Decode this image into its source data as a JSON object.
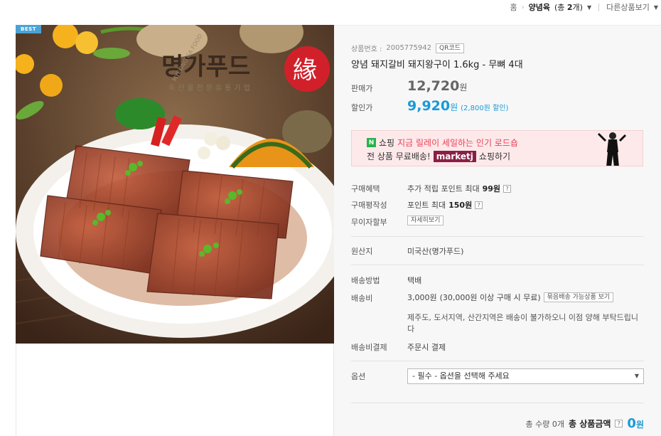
{
  "breadcrumb": {
    "home": "홈",
    "category": "양념육",
    "count_prefix": "(총 ",
    "count": "2",
    "count_suffix": "개)",
    "other_products": "다른상품보기"
  },
  "badge": "BEST",
  "logo": {
    "text": "명가푸드",
    "seal": "緣",
    "sub": "축산물전문유통기업",
    "arc": "MYEONG GA FOOD"
  },
  "product": {
    "number_label": "상품번호 :",
    "number": "2005775942",
    "qr_label": "QR코드",
    "title": "양념 돼지갈비 돼지왕구이 1.6kg - 무뼈 4대"
  },
  "price": {
    "sell_label": "판매가",
    "sell_value": "12,720",
    "unit": "원",
    "sale_label": "할인가",
    "sale_value": "9,920",
    "discount": "(2,800원 할인)"
  },
  "banner": {
    "line1_brand": "쇼핑",
    "line1_highlight": "지금 릴레이 세일하는 인기 로드숍",
    "line2_prefix": "전 상품 무료배송!",
    "line2_badge": "marketj",
    "line2_suffix": "쇼핑하기"
  },
  "benefits": {
    "purchase_label": "구매혜택",
    "purchase_text": "추가 적립 포인트 최대",
    "purchase_value": "99원",
    "review_label": "구매평작성",
    "review_text": "포인트 최대",
    "review_value": "150원",
    "installment_label": "무이자할부",
    "installment_button": "자세히보기"
  },
  "origin": {
    "label": "원산지",
    "value": "미국산(명가푸드)"
  },
  "shipping": {
    "method_label": "배송방법",
    "method_value": "택배",
    "fee_label": "배송비",
    "fee_value": "3,000원",
    "fee_note": "(30,000원 이상 구매 시 무료)",
    "bundle_button": "묶음배송 가능상품 보기",
    "fee_desc": "제주도, 도서지역, 산간지역은 배송이 불가하오니 이점 양해 부탁드립니다",
    "payment_label": "배송비결제",
    "payment_value": "주문시 결제"
  },
  "option": {
    "label": "옵션",
    "placeholder": "- 필수 - 옵션을 선택해 주세요"
  },
  "total": {
    "qty_text": "총 수량 0개",
    "amount_label": "총 상품금액",
    "amount_value": "0",
    "unit": "원"
  },
  "colors": {
    "accent": "#1a9ad6",
    "best_badge": "#4aa3d6",
    "banner_bg": "#fde9ea",
    "banner_highlight": "#e8435a",
    "marketj": "#8a1f44"
  }
}
